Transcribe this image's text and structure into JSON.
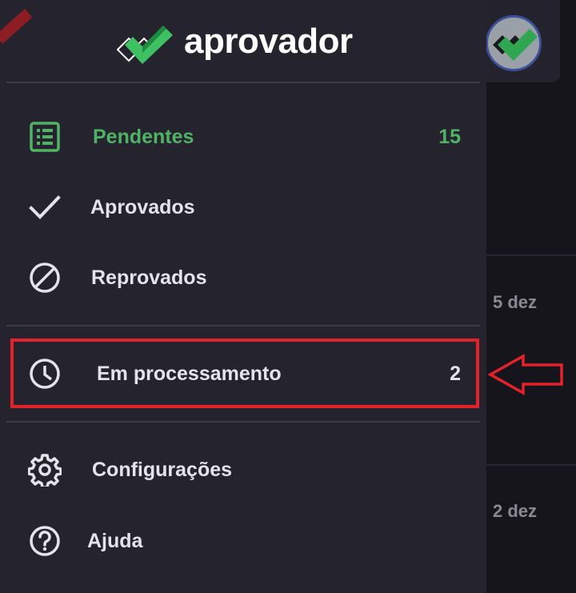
{
  "brand": {
    "name": "aprovador",
    "logo_icon": "double-check-logo",
    "colors": {
      "green": "#3ec162",
      "dark_green": "#1e8b3c"
    }
  },
  "nav": {
    "items": [
      {
        "id": "pendentes",
        "label": "Pendentes",
        "icon": "list-icon",
        "count": "15",
        "active": true
      },
      {
        "id": "aprovados",
        "label": "Aprovados",
        "icon": "check-icon",
        "count": "",
        "active": false
      },
      {
        "id": "reprovados",
        "label": "Reprovados",
        "icon": "block-icon",
        "count": "",
        "active": false
      },
      {
        "id": "em-processamento",
        "label": "Em processamento",
        "icon": "clock-icon",
        "count": "2",
        "active": false
      },
      {
        "id": "configuracoes",
        "label": "Configurações",
        "icon": "gear-icon",
        "count": "",
        "active": false
      },
      {
        "id": "ajuda",
        "label": "Ajuda",
        "icon": "help-icon",
        "count": "",
        "active": false
      }
    ],
    "accent_color": "#4fb365",
    "text_color": "#e4e3ea"
  },
  "annotation": {
    "highlight_color": "#e3222b",
    "arrow_icon": "left-arrow-icon"
  },
  "background": {
    "dates": [
      "5 dez",
      "2 dez"
    ]
  }
}
